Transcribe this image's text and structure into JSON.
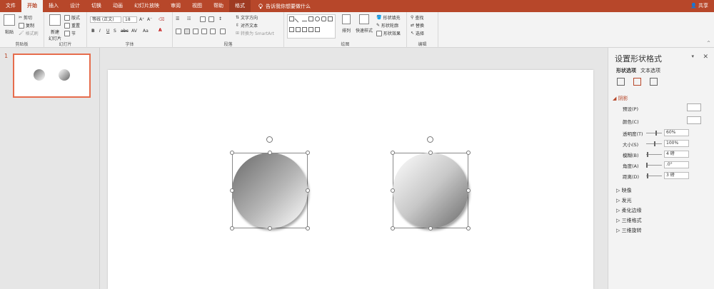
{
  "menu": {
    "tabs": [
      "文件",
      "开始",
      "插入",
      "设计",
      "切换",
      "动画",
      "幻灯片放映",
      "审阅",
      "视图",
      "帮助",
      "格式"
    ],
    "active_index": 1,
    "search_text": "告诉我你想要做什么",
    "share": "共享"
  },
  "ribbon": {
    "clipboard": {
      "paste": "粘贴",
      "cut": "剪切",
      "copy": "复制",
      "format_painter": "格式刷",
      "label": "剪贴板"
    },
    "slides": {
      "new_slide": "新建\n幻灯片",
      "layout": "版式",
      "reset": "重置",
      "section": "节",
      "label": "幻灯片"
    },
    "font": {
      "font_name": "等线 (正文)",
      "font_size": "18",
      "label": "字体",
      "bold": "B",
      "italic": "I",
      "underline": "U",
      "strike": "S",
      "shadow": "abc",
      "spacing": "AV",
      "case": "Aa"
    },
    "paragraph": {
      "text_direction": "文字方向",
      "align_text": "对齐文本",
      "smartart": "转换为 SmartArt",
      "label": "段落"
    },
    "drawing": {
      "arrange": "排列",
      "quick_styles": "快速样式",
      "shape_fill": "形状填充",
      "shape_outline": "形状轮廓",
      "shape_effects": "形状效果",
      "label": "绘图"
    },
    "editing": {
      "find": "查找",
      "replace": "替换",
      "select": "选择",
      "label": "编辑"
    }
  },
  "thumbnails": [
    {
      "number": "1"
    }
  ],
  "panel": {
    "title": "设置形状格式",
    "tab_shape": "形状选项",
    "tab_text": "文本选项",
    "section": "阴影",
    "rows": [
      {
        "label": "预设(P)"
      },
      {
        "label": "颜色(C)"
      },
      {
        "label": "透明度(T)",
        "value": "60%",
        "slider": 0.6
      },
      {
        "label": "大小(S)",
        "value": "100%",
        "slider": 0.5
      },
      {
        "label": "模糊(B)",
        "value": "4 磅",
        "slider": 0.05
      },
      {
        "label": "角度(A)",
        "value": ".0°",
        "slider": 0.0
      },
      {
        "label": "距离(D)",
        "value": "3 磅",
        "slider": 0.03
      }
    ],
    "collapsed": [
      "映像",
      "发光",
      "柔化边缘",
      "三维格式",
      "三维旋转"
    ]
  },
  "colors": {
    "accent": "#b7472a",
    "ribbon": "#f3f3f3",
    "app_bg": "#e6e6e6"
  }
}
